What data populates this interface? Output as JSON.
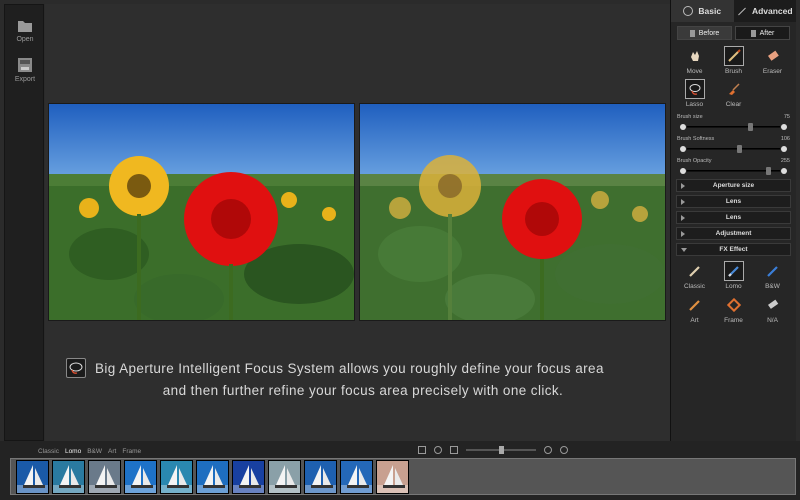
{
  "toolbar": {
    "open_label": "Open",
    "export_label": "Export"
  },
  "panel": {
    "tabs": [
      {
        "label": "Basic",
        "active": true
      },
      {
        "label": "Advanced",
        "active": false
      }
    ],
    "before_label": "Before",
    "after_label": "After",
    "tools": [
      {
        "label": "Move",
        "icon": "move-hand-icon"
      },
      {
        "label": "Brush",
        "icon": "brush-icon",
        "active": true
      },
      {
        "label": "Eraser",
        "icon": "eraser-icon"
      },
      {
        "label": "Lasso",
        "icon": "lasso-icon",
        "active": true
      },
      {
        "label": "Clear",
        "icon": "clear-broom-icon"
      }
    ],
    "sliders": [
      {
        "label": "Brush size",
        "value": "75",
        "fraction": 0.68
      },
      {
        "label": "Brush Softness",
        "value": "106",
        "fraction": 0.55
      },
      {
        "label": "Brush Opacity",
        "value": "255",
        "fraction": 0.88
      }
    ],
    "sections": [
      {
        "label": "Aperture size",
        "expanded": false
      },
      {
        "label": "Lens",
        "expanded": false
      },
      {
        "label": "Lens",
        "expanded": false
      },
      {
        "label": "Adjustment",
        "expanded": false
      },
      {
        "label": "FX Effect",
        "expanded": true
      }
    ],
    "fx": [
      {
        "label": "Classic",
        "icon": "classic-brush-icon"
      },
      {
        "label": "Lomo",
        "icon": "lomo-brush-icon",
        "active": true
      },
      {
        "label": "B&W",
        "icon": "bw-pencil-icon"
      },
      {
        "label": "Art",
        "icon": "art-brush-icon"
      },
      {
        "label": "Frame",
        "icon": "frame-icon"
      },
      {
        "label": "N/A",
        "icon": "na-eraser-icon"
      }
    ]
  },
  "caption": {
    "line1": "Big Aperture Intelligent Focus System allows you roughly define your focus area",
    "line2": "and then further refine your focus area precisely with one click."
  },
  "bottom": {
    "tabs": [
      {
        "label": "Classic",
        "active": false
      },
      {
        "label": "Lomo",
        "active": true
      },
      {
        "label": "B&W",
        "active": false
      },
      {
        "label": "Art",
        "active": false
      },
      {
        "label": "Frame",
        "active": false
      }
    ],
    "zoom_fraction": 0.5,
    "thumb_count": 11
  },
  "colors": {
    "accent_red": "#e01010",
    "sky": "#2a6fc9"
  }
}
